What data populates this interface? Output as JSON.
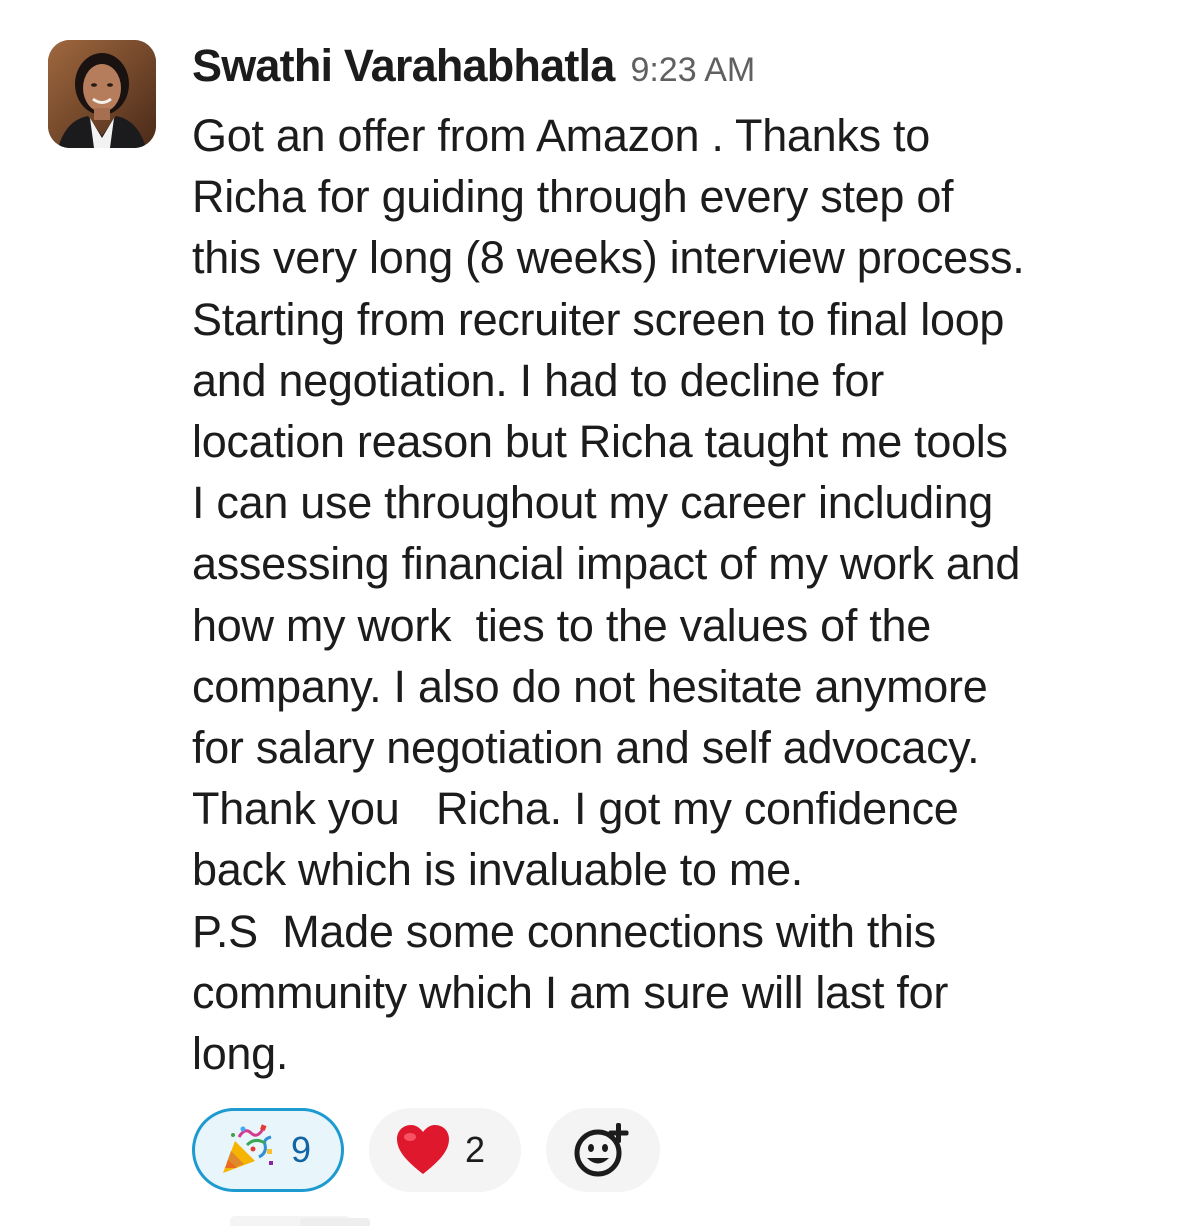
{
  "message": {
    "author": "Swathi Varahabhatla",
    "timestamp": "9:23 AM",
    "lines": [
      "Got an offer from Amazon . Thanks to",
      "Richa for guiding through every step of",
      "this very long (8 weeks) interview process.",
      "Starting from recruiter screen to final loop",
      "and negotiation. I had to decline for",
      "location reason but Richa taught me tools",
      "I can use throughout my career including",
      "assessing financial impact of my work and",
      "how my work  ties to the values of the",
      "company. I also do not hesitate anymore",
      "for salary negotiation and self advocacy.",
      "Thank you   Richa. I got my confidence",
      "back which is invaluable to me.",
      "P.S  Made some connections with this",
      "community which I am sure will last for",
      "long."
    ]
  },
  "reactions": [
    {
      "emoji": "party-popper-icon",
      "count": "9",
      "selected": true
    },
    {
      "emoji": "red-heart-icon",
      "count": "2",
      "selected": false
    }
  ],
  "add_reaction": {
    "icon": "add-emoji-icon"
  },
  "colors": {
    "text": "#1d1c1d",
    "timestamp": "#616061",
    "selected_border": "#1d9bd1",
    "selected_bg": "#e8f5fa",
    "selected_count": "#1264a3",
    "pill_bg": "#f4f4f4",
    "heart": "#e0182d"
  }
}
